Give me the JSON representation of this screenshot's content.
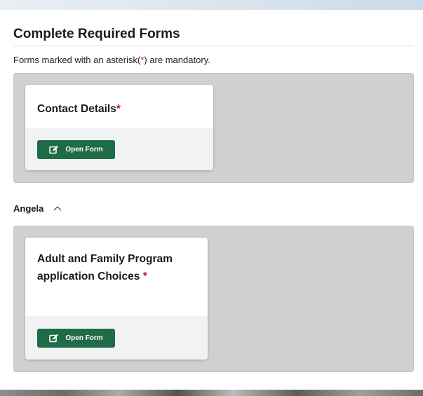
{
  "page": {
    "title": "Complete Required Forms",
    "notice_prefix": "Forms marked with an asterisk(",
    "notice_asterisk": "*",
    "notice_suffix": ") are mandatory."
  },
  "forms_group": {
    "cards": [
      {
        "title": "Contact Details",
        "required_mark": "*",
        "button_label": "Open Form",
        "button_icon": "edit-icon"
      }
    ]
  },
  "person_group": {
    "name": "Angela",
    "toggle_icon": "chevron-up-icon",
    "cards": [
      {
        "title": "Adult and Family Program application Choices",
        "required_mark": "*",
        "button_label": "Open Form",
        "button_icon": "edit-icon"
      }
    ]
  },
  "colors": {
    "button_bg": "#1f6b47",
    "required_mark": "#c8102e",
    "panel_bg": "#cfd0d2",
    "card_footer_bg": "#f1f2f3"
  }
}
